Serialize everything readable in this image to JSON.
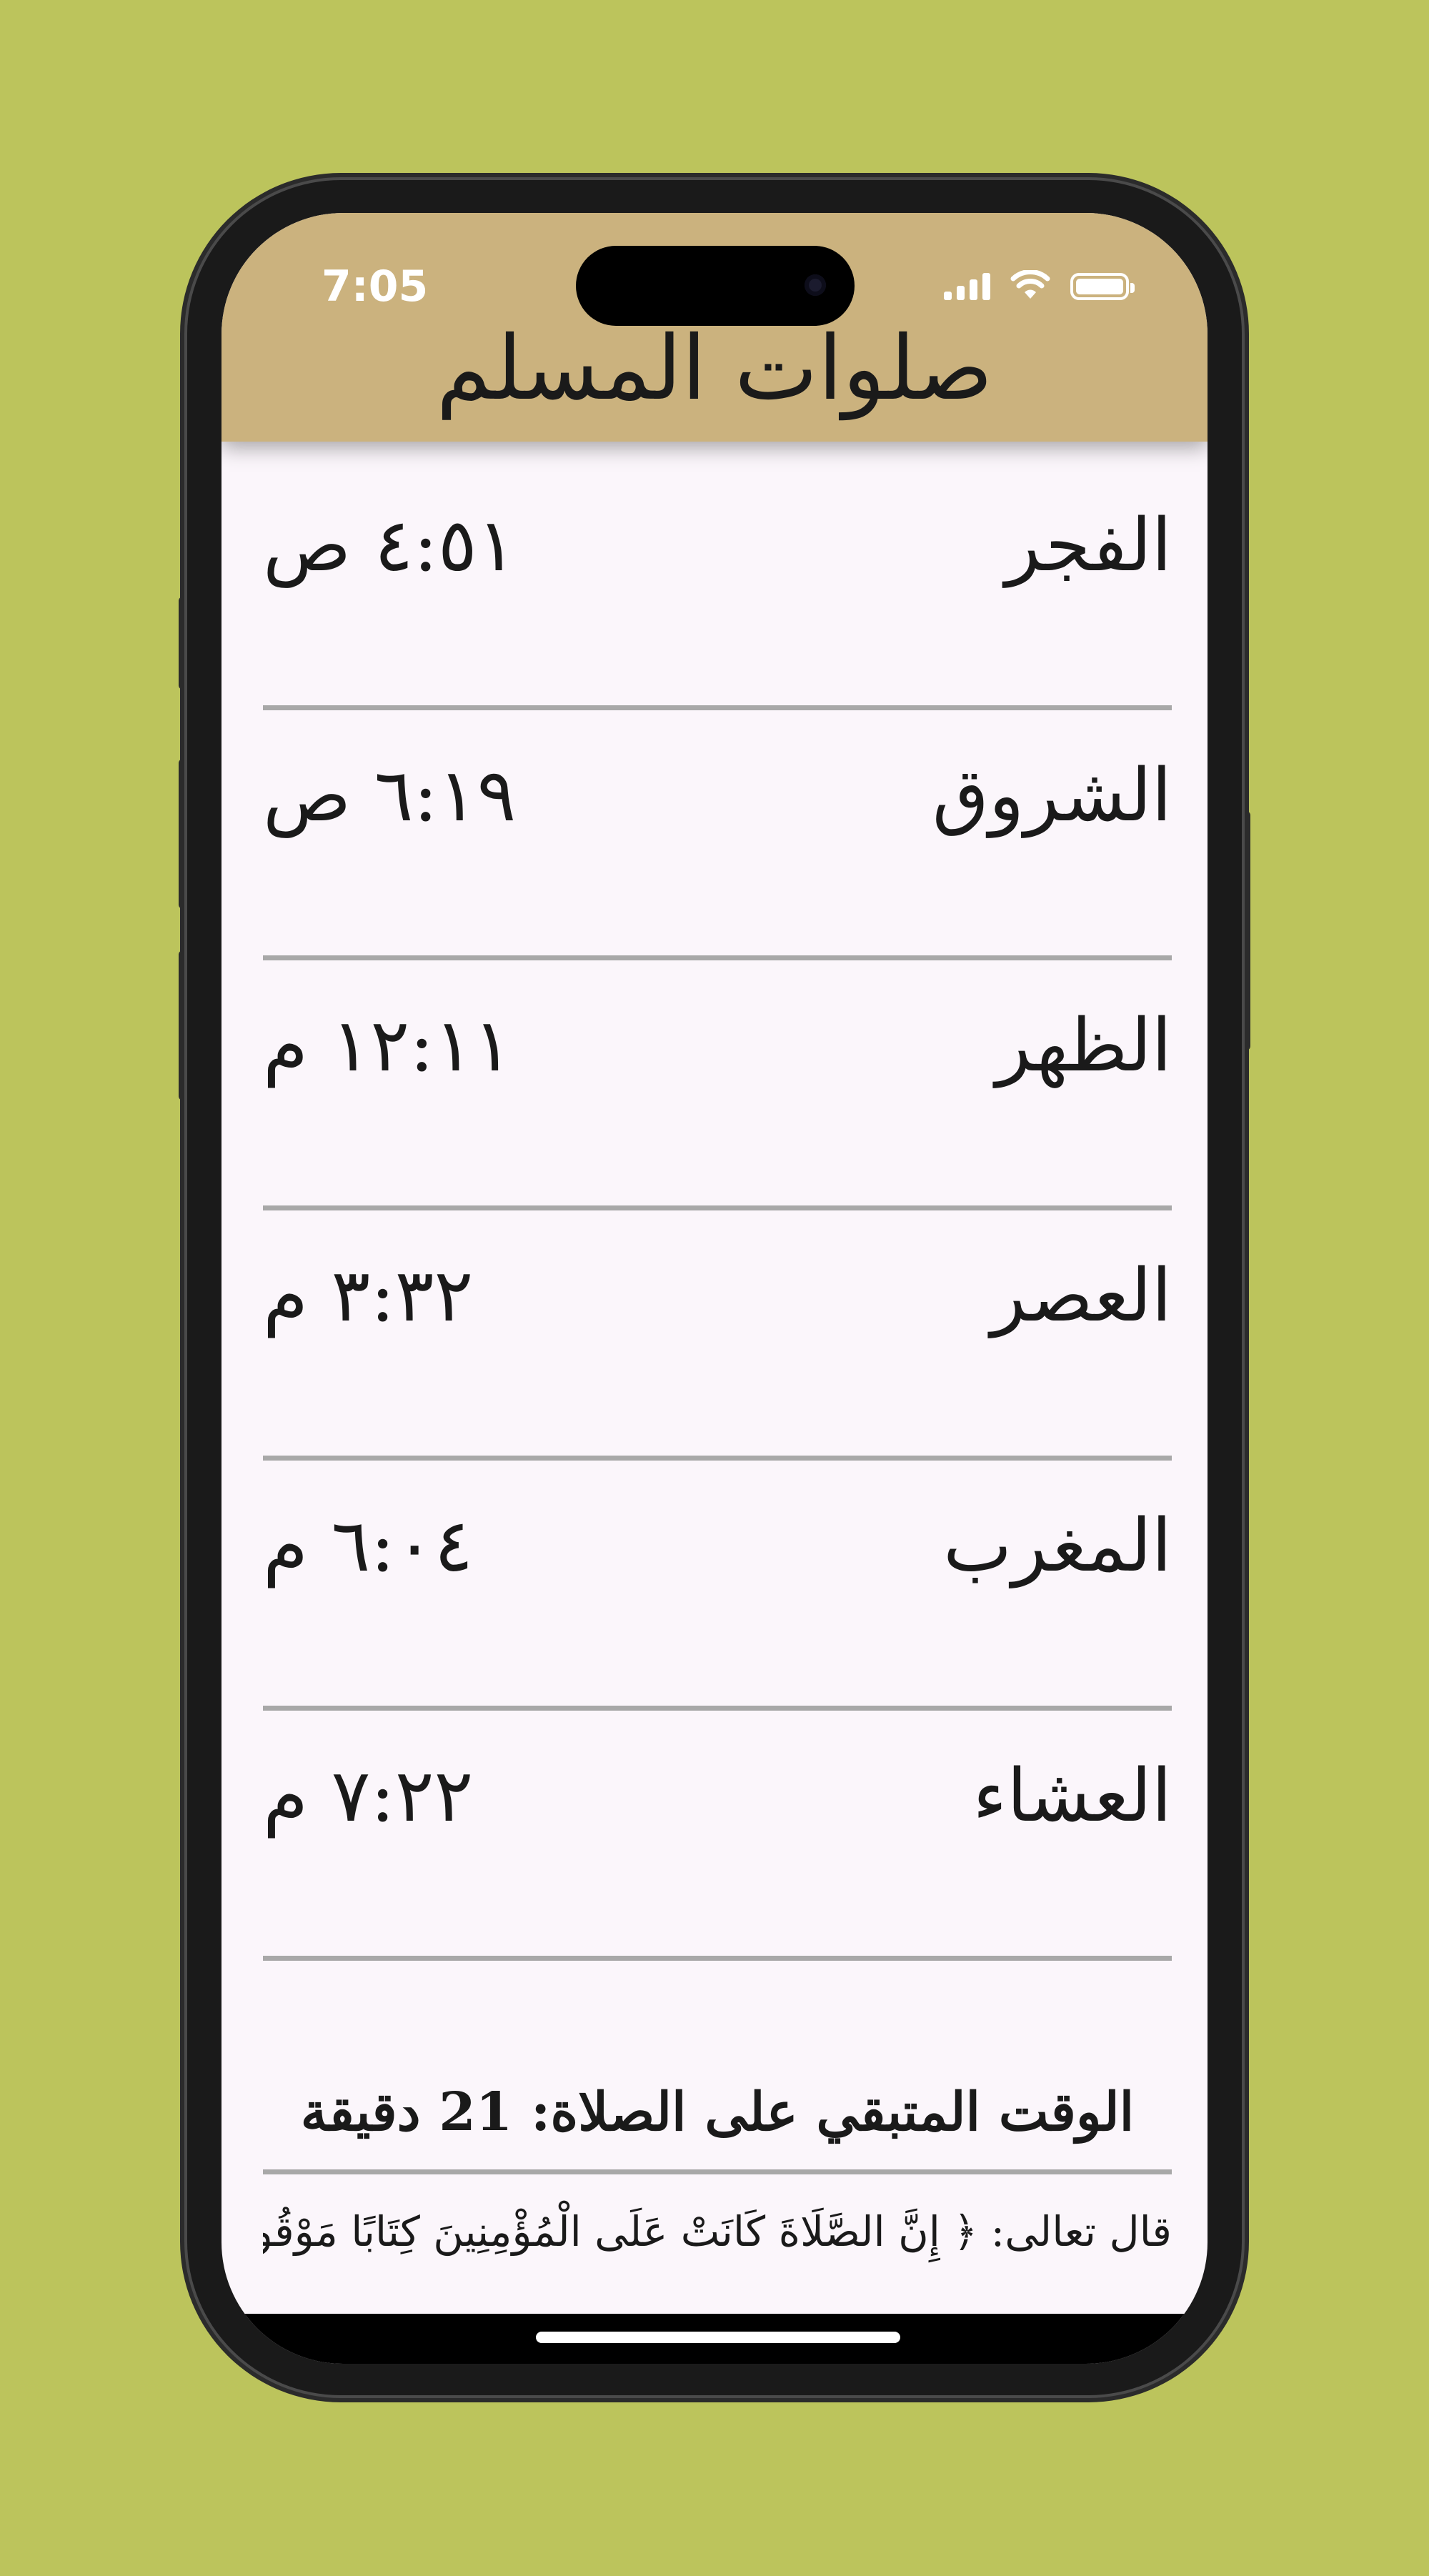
{
  "status_bar": {
    "time": "7:05"
  },
  "header": {
    "title": "صلوات المسلم"
  },
  "prayers": [
    {
      "name": "الفجر",
      "time": "٤:٥١ ص"
    },
    {
      "name": "الشروق",
      "time": "٦:١٩ ص"
    },
    {
      "name": "الظهر",
      "time": "١٢:١١ م"
    },
    {
      "name": "العصر",
      "time": "٣:٣٢ م"
    },
    {
      "name": "المغرب",
      "time": "٦:٠٤ م"
    },
    {
      "name": "العشاء",
      "time": "٧:٢٢ م"
    }
  ],
  "remaining_text": "الوقت المتبقي على الصلاة: 21 دقيقة",
  "verse": "قال تعالى: ﴿ إِنَّ الصَّلَاةَ كَانَتْ عَلَى الْمُؤْمِنِينَ كِتَابًا مَوْقُوتًا ﴾",
  "colors": {
    "background": "#bcc45c",
    "header": "#cbb27e",
    "screen": "#fbf6fb",
    "divider": "#a8a8a8"
  },
  "icons": [
    "signal-icon",
    "wifi-icon",
    "battery-icon"
  ]
}
